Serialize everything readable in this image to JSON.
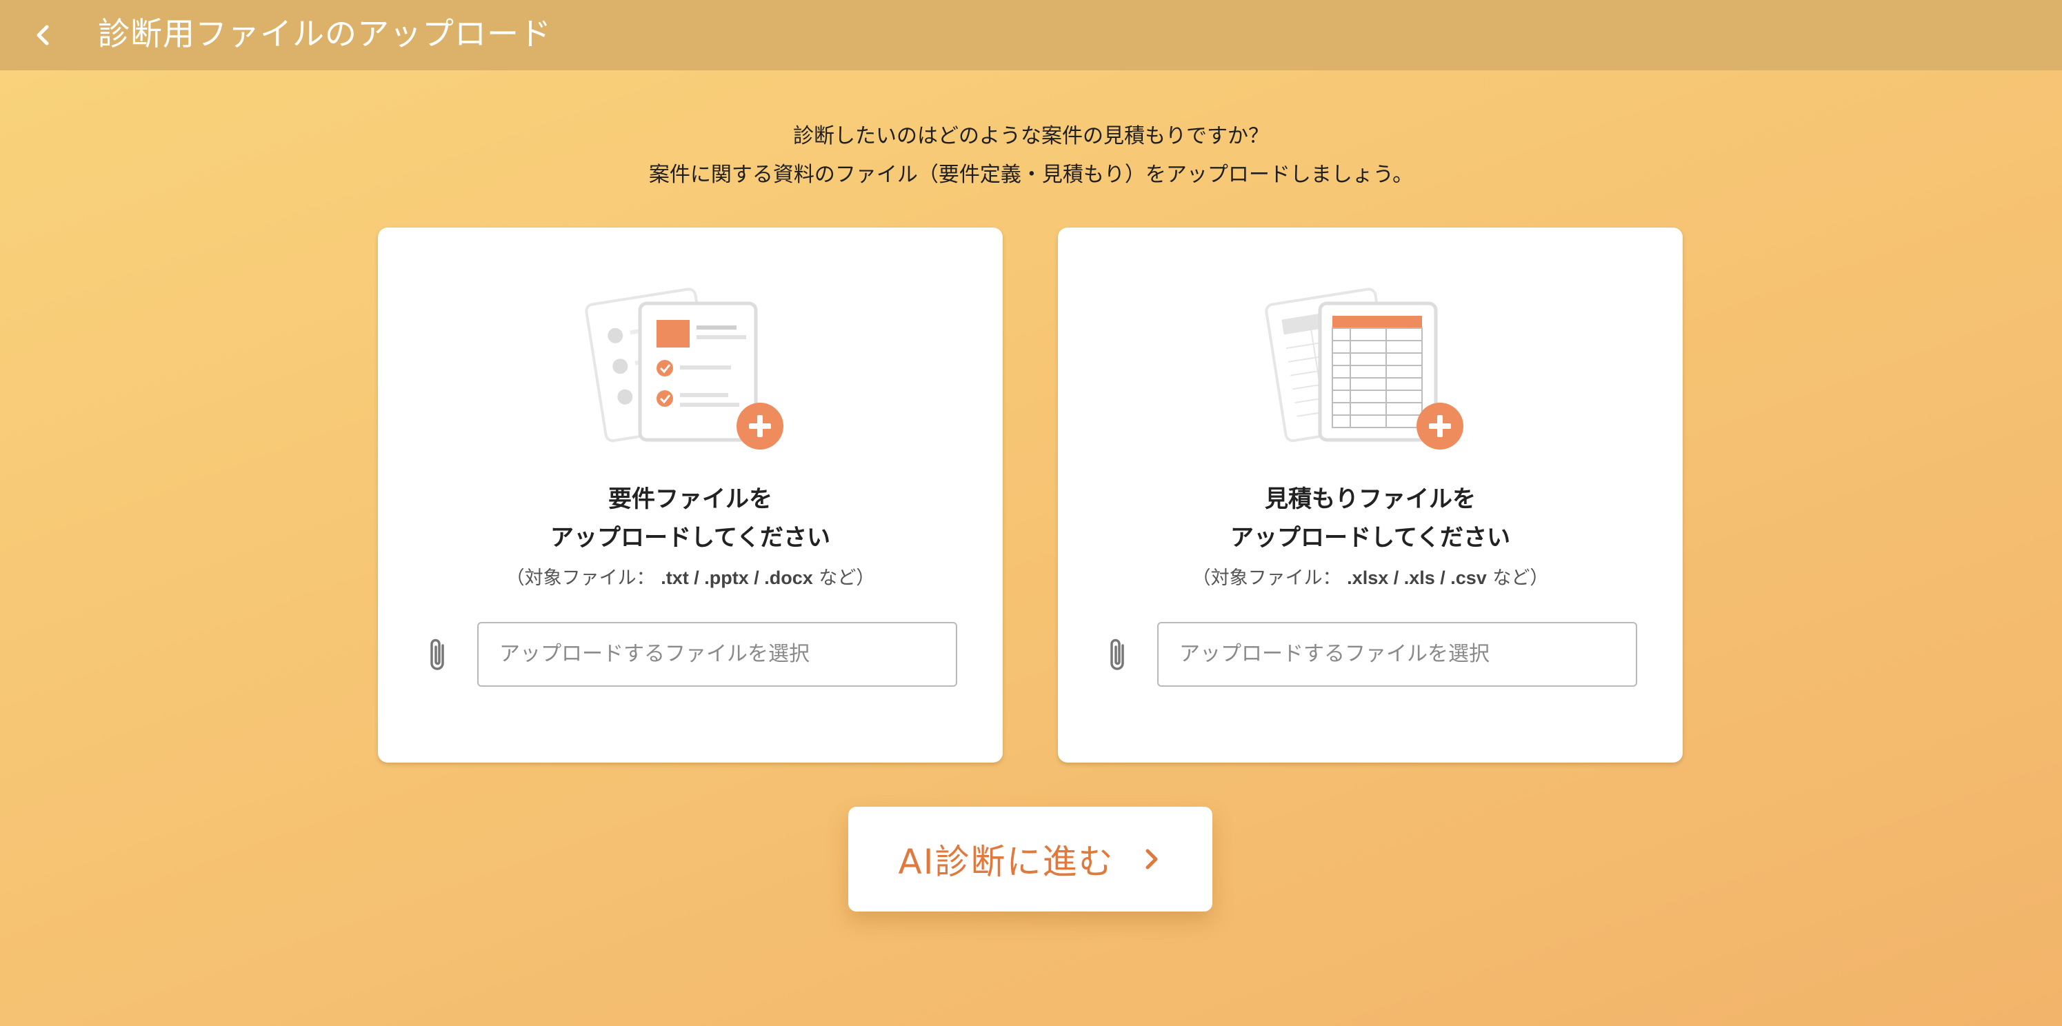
{
  "header": {
    "back_icon": "chevron-left-icon",
    "title": "診断用ファイルのアップロード"
  },
  "intro": {
    "line1": "診断したいのはどのような案件の見積もりですか？",
    "line2": "案件に関する資料のファイル（要件定義・見積もり）をアップロードしましょう。"
  },
  "cards": [
    {
      "icon": "requirements-document-add-icon",
      "heading_line1": "要件ファイルを",
      "heading_line2": "アップロードしてください",
      "note_prefix": "（対象ファイル：",
      "note_exts": ".txt / .pptx / .docx",
      "note_suffix": "など）",
      "input_placeholder": "アップロードするファイルを選択"
    },
    {
      "icon": "estimate-spreadsheet-add-icon",
      "heading_line1": "見積もりファイルを",
      "heading_line2": "アップロードしてください",
      "note_prefix": "（対象ファイル：",
      "note_exts": ".xlsx / .xls / .csv",
      "note_suffix": "など）",
      "input_placeholder": "アップロードするファイルを選択"
    }
  ],
  "cta": {
    "label": "AI診断に進む",
    "icon": "chevron-right-icon"
  },
  "colors": {
    "accent": "#e0793d",
    "illustration_orange": "#ef8c5e",
    "header_bg": "#dcb26a",
    "background_top": "#f9d37c",
    "background_bottom": "#f2b46a"
  }
}
